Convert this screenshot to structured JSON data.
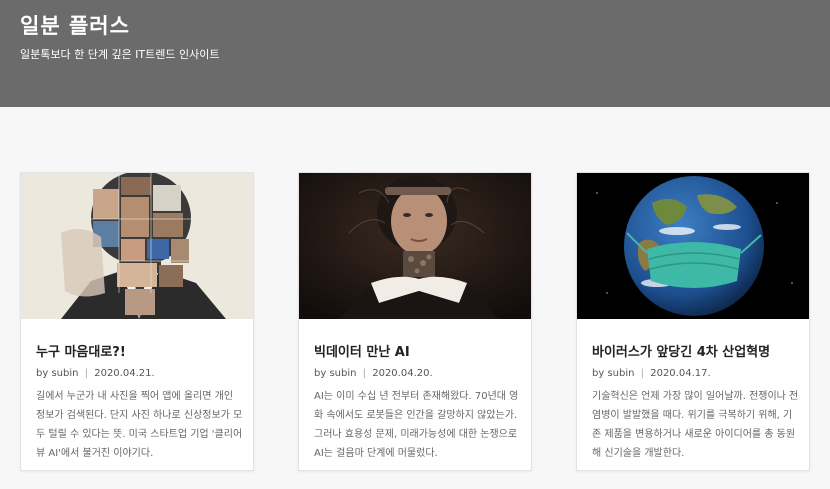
{
  "site": {
    "title": "일분 플러스",
    "description": "일분톡보다 한 단계 깊은 IT트렌드 인사이트"
  },
  "posts": [
    {
      "title": "누구 마음대로?!",
      "by": "by",
      "author": "subin",
      "date": "2020.04.21.",
      "excerpt": "길에서 누군가 내 사진을 찍어 앱에 올리면 개인 정보가 검색된다. 단지 사진 하나로 신상정보가 모두 털릴 수 있다는 뜻. 미국 스타트업 기업 '클리어뷰 AI'에서 불거진 이야기다.",
      "image": "face-collage-illustration"
    },
    {
      "title": "빅데이터 만난 AI",
      "by": "by",
      "author": "subin",
      "date": "2020.04.20.",
      "excerpt": "AI는 이미 수십 년 전부터 존재해왔다. 70년대 영화 속에서도 로봇들은 인간을 갈망하지 않았는가. 그러나 효용성 문제, 미래가능성에 대한 논쟁으로 AI는 걸음마 단계에 머물렀다.",
      "image": "android-woman-portrait"
    },
    {
      "title": "바이러스가 앞당긴 4차 산업혁명",
      "by": "by",
      "author": "subin",
      "date": "2020.04.17.",
      "excerpt": "기술혁신은 언제 가장 많이 일어날까. 전쟁이나 전염병이 발발했을 때다. 위기를 극복하기 위해, 기존 제품을 변용하거나 새로운 아이디어를 총 동원해 신기술을 개발한다.",
      "image": "earth-with-face-mask"
    }
  ]
}
